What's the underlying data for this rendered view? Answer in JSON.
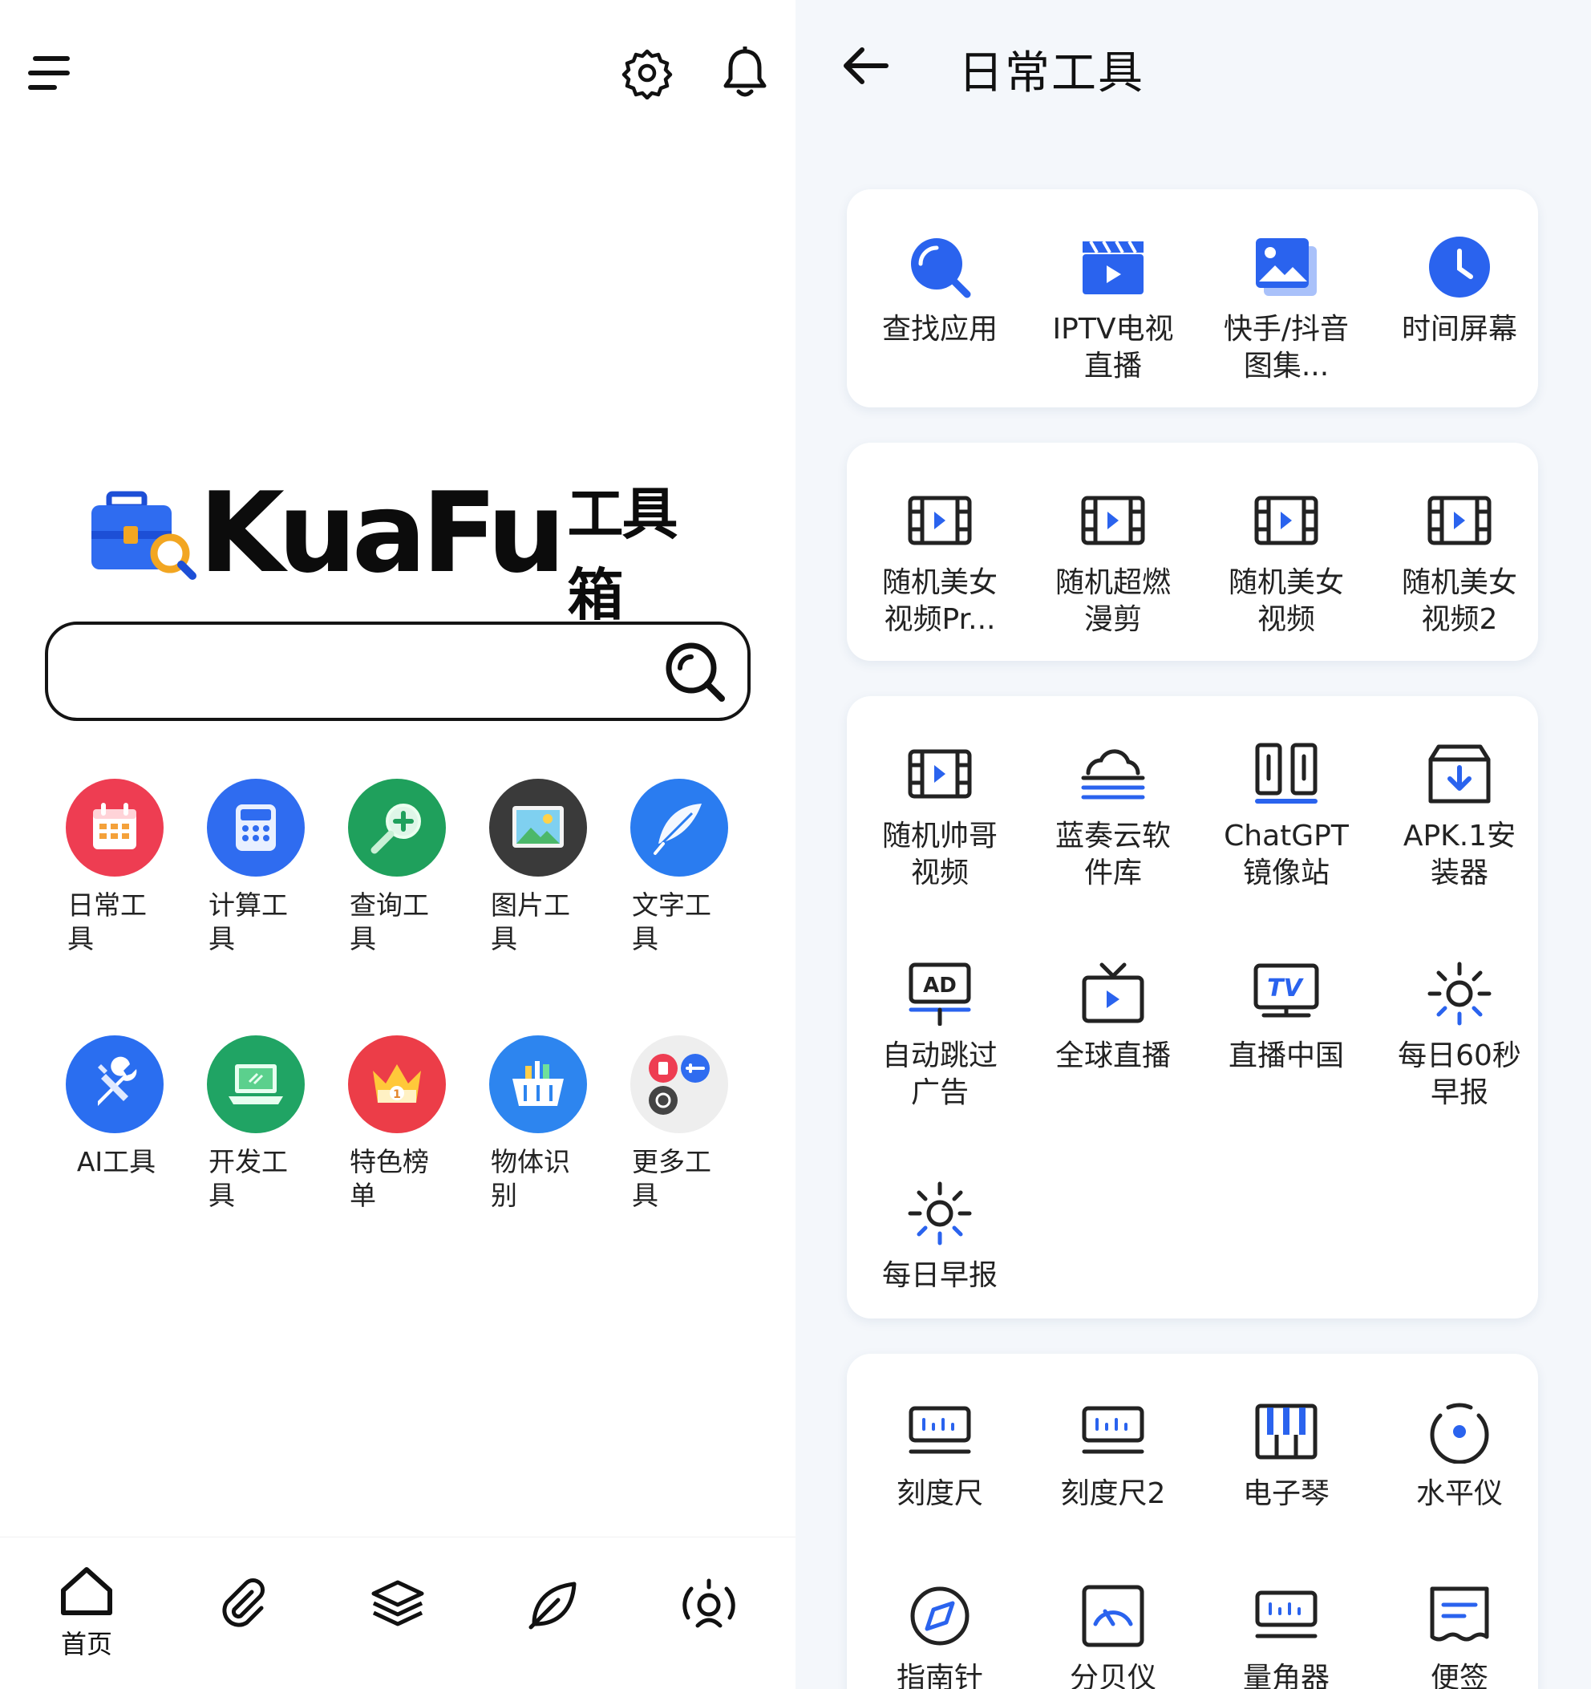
{
  "left": {
    "logo": {
      "brand": "KuaFu",
      "brand_cn": "工具箱"
    },
    "search": {
      "placeholder": ""
    },
    "categories": [
      {
        "label": "日常工具",
        "icon": "calendar-icon",
        "color": "#ee3d52"
      },
      {
        "label": "计算工具",
        "icon": "calculator-icon",
        "color": "#2f6cf0"
      },
      {
        "label": "查询工具",
        "icon": "magnifier-plus-icon",
        "color": "#1fa05c"
      },
      {
        "label": "图片工具",
        "icon": "picture-icon",
        "color": "#3a3a3a"
      },
      {
        "label": "文字工具",
        "icon": "feather-icon",
        "color": "#2a7cf0"
      },
      {
        "label": "AI工具",
        "icon": "wrench-screwdriver-icon",
        "color": "#2a6ef0"
      },
      {
        "label": "开发工具",
        "icon": "laptop-icon",
        "color": "#20a464"
      },
      {
        "label": "特色榜单",
        "icon": "crown-icon",
        "color": "#ec3d48"
      },
      {
        "label": "物体识别",
        "icon": "basket-icon",
        "color": "#2d85ef"
      },
      {
        "label": "更多工具",
        "icon": "more-apps-icon",
        "color": "#eeeeee"
      }
    ],
    "bottom_nav": {
      "home_label": "首页"
    }
  },
  "right": {
    "title": "日常工具",
    "cards": [
      [
        {
          "label": "查找应用",
          "icon": "search-icon"
        },
        {
          "label": "IPTV电视直播",
          "icon": "clapperboard-icon"
        },
        {
          "label": "快手/抖音图集...",
          "icon": "gallery-icon"
        },
        {
          "label": "时间屏幕",
          "icon": "clock-icon"
        }
      ],
      [
        {
          "label": "随机美女视频Pr...",
          "icon": "film-icon"
        },
        {
          "label": "随机超燃漫剪",
          "icon": "film-icon"
        },
        {
          "label": "随机美女视频",
          "icon": "film-icon"
        },
        {
          "label": "随机美女视频2",
          "icon": "film-icon"
        }
      ],
      [
        {
          "label": "随机帅哥视频",
          "icon": "film-icon"
        },
        {
          "label": "蓝奏云软件库",
          "icon": "cloud-icon"
        },
        {
          "label": "ChatGPT镜像站",
          "icon": "columns-icon"
        },
        {
          "label": "APK.1安装器",
          "icon": "download-box-icon"
        },
        {
          "label": "自动跳过广告",
          "icon": "ad-sign-icon"
        },
        {
          "label": "全球直播",
          "icon": "tv-play-icon"
        },
        {
          "label": "直播中国",
          "icon": "tv-monitor-icon"
        },
        {
          "label": "每日60秒早报",
          "icon": "sun-icon"
        },
        {
          "label": "每日早报",
          "icon": "sun-icon"
        }
      ],
      [
        {
          "label": "刻度尺",
          "icon": "ruler-icon"
        },
        {
          "label": "刻度尺2",
          "icon": "ruler-icon"
        },
        {
          "label": "电子琴",
          "icon": "piano-icon"
        },
        {
          "label": "水平仪",
          "icon": "level-icon"
        },
        {
          "label": "指南针",
          "icon": "compass-icon"
        },
        {
          "label": "分贝仪",
          "icon": "decibel-icon"
        },
        {
          "label": "量角器",
          "icon": "ruler-icon"
        },
        {
          "label": "便签",
          "icon": "note-icon"
        }
      ]
    ]
  },
  "colors": {
    "accent": "#2a63ee",
    "ink": "#1f1f1f"
  }
}
